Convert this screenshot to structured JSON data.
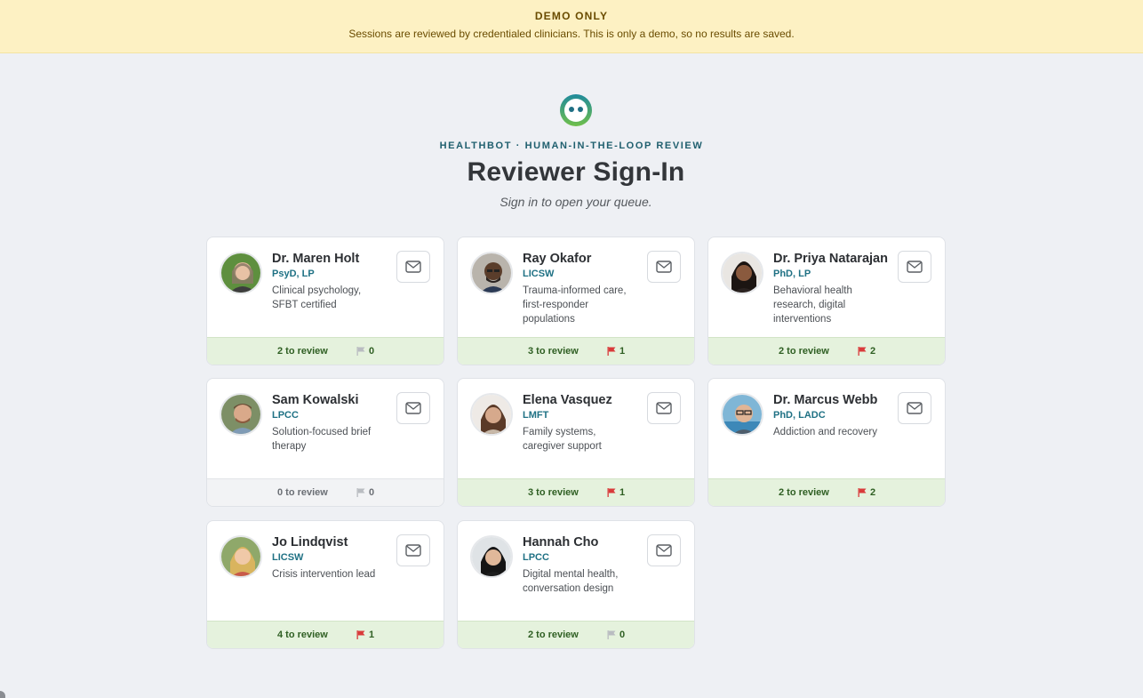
{
  "banner": {
    "title": "DEMO ONLY",
    "text": "Sessions are reviewed by credentialed clinicians. This is only a demo, so no results are saved."
  },
  "header": {
    "eyebrow": "HEALTHBOT · HUMAN-IN-THE-LOOP REVIEW",
    "title": "Reviewer Sign-In",
    "subtitle": "Sign in to open your queue."
  },
  "colors": {
    "brand": "#1f7184",
    "flag_active": "#d93a3a",
    "flag_inactive": "#b9bcc1",
    "footer_green": "#e5f2dd"
  },
  "reviewers": [
    {
      "name": "Dr. Maren Holt",
      "credentials": "PsyD, LP",
      "description": "Clinical psychology, SFBT certified",
      "review_label": "2 to review",
      "flags": "0"
    },
    {
      "name": "Ray Okafor",
      "credentials": "LICSW",
      "description": "Trauma-informed care, first-responder populations",
      "review_label": "3 to review",
      "flags": "1"
    },
    {
      "name": "Dr. Priya Natarajan",
      "credentials": "PhD, LP",
      "description": "Behavioral health research, digital interventions",
      "review_label": "2 to review",
      "flags": "2"
    },
    {
      "name": "Sam Kowalski",
      "credentials": "LPCC",
      "description": "Solution-focused brief therapy",
      "review_label": "0 to review",
      "flags": "0"
    },
    {
      "name": "Elena Vasquez",
      "credentials": "LMFT",
      "description": "Family systems, caregiver support",
      "review_label": "3 to review",
      "flags": "1"
    },
    {
      "name": "Dr. Marcus Webb",
      "credentials": "PhD, LADC",
      "description": "Addiction and recovery",
      "review_label": "2 to review",
      "flags": "2"
    },
    {
      "name": "Jo Lindqvist",
      "credentials": "LICSW",
      "description": "Crisis intervention lead",
      "review_label": "4 to review",
      "flags": "1"
    },
    {
      "name": "Hannah Cho",
      "credentials": "LPCC",
      "description": "Digital mental health, conversation design",
      "review_label": "2 to review",
      "flags": "0"
    }
  ],
  "icons": {
    "logo": "chatbot-face-icon",
    "mail": "mail-icon",
    "flag": "flag-icon",
    "avatar": "reviewer-avatar"
  }
}
